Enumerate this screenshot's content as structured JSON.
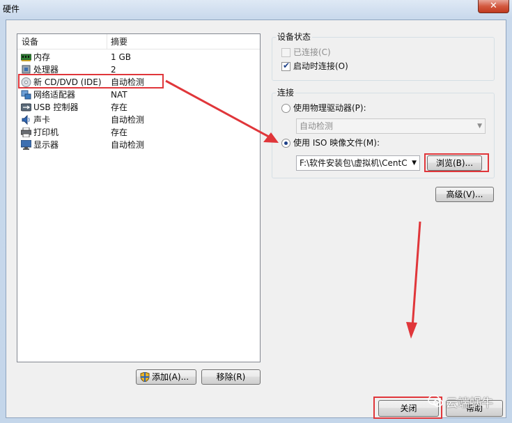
{
  "window": {
    "title": "硬件",
    "close_glyph": "✕"
  },
  "device_list": {
    "columns": [
      "设备",
      "摘要"
    ],
    "rows": [
      {
        "name": "内存",
        "summary": "1 GB",
        "icon": "memory-icon"
      },
      {
        "name": "处理器",
        "summary": "2",
        "icon": "processor-icon"
      },
      {
        "name": "新 CD/DVD (IDE)",
        "summary": "自动检测",
        "icon": "cd-dvd-icon"
      },
      {
        "name": "网络适配器",
        "summary": "NAT",
        "icon": "network-adapter-icon"
      },
      {
        "name": "USB 控制器",
        "summary": "存在",
        "icon": "usb-icon"
      },
      {
        "name": "声卡",
        "summary": "自动检测",
        "icon": "sound-card-icon"
      },
      {
        "name": "打印机",
        "summary": "存在",
        "icon": "printer-icon"
      },
      {
        "name": "显示器",
        "summary": "自动检测",
        "icon": "display-icon"
      }
    ]
  },
  "buttons": {
    "add": "添加(A)...",
    "remove": "移除(R)",
    "browse": "浏览(B)...",
    "advanced": "高级(V)...",
    "close": "关闭",
    "help": "帮助"
  },
  "device_status": {
    "title": "设备状态",
    "connected": {
      "label": "已连接(C)",
      "checked": false,
      "enabled": false
    },
    "connect_at_power_on": {
      "label": "启动时连接(O)",
      "checked": true
    }
  },
  "connection": {
    "title": "连接",
    "physical_drive": {
      "label": "使用物理驱动器(P):",
      "selected": false
    },
    "physical_drive_value": "自动检测",
    "iso_image": {
      "label": "使用 ISO 映像文件(M):",
      "selected": true
    },
    "iso_path": "F:\\软件安装包\\虚拟机\\CentC"
  },
  "watermark": {
    "text": "云端蜗牛"
  },
  "colors": {
    "annotation_red": "#e0363a"
  }
}
